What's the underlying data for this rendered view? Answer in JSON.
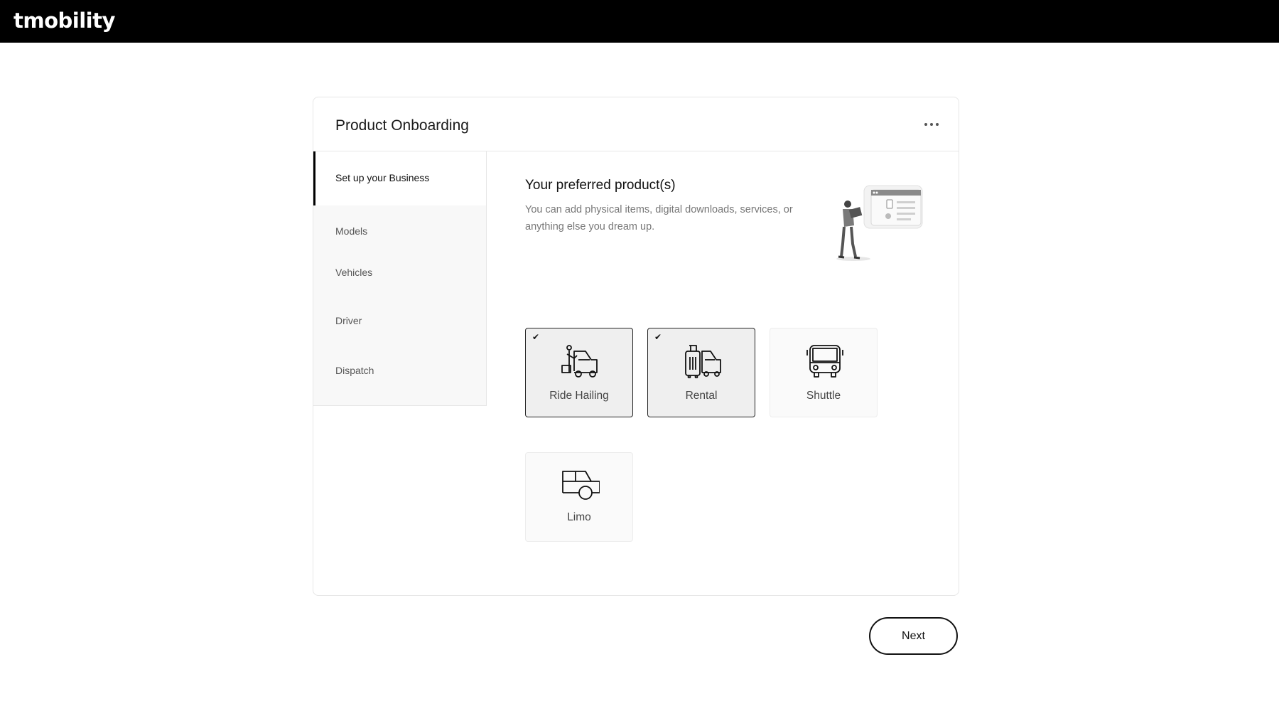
{
  "app": {
    "brand": "tmobility"
  },
  "card": {
    "title": "Product Onboarding",
    "more_icon": "more-horizontal-icon"
  },
  "sidebar": {
    "items": [
      {
        "label": "Set up your Business",
        "active": true
      },
      {
        "label": "Models",
        "active": false
      },
      {
        "label": "Vehicles",
        "active": false
      },
      {
        "label": "Driver",
        "active": false
      },
      {
        "label": "Dispatch",
        "active": false
      }
    ]
  },
  "section": {
    "title": "Your preferred product(s)",
    "description": "You can add physical items, digital downloads, services, or anything else you dream up.",
    "illustration": "person-with-box-illustration"
  },
  "products": [
    {
      "label": "Ride Hailing",
      "icon": "ride-hailing-icon",
      "selected": true
    },
    {
      "label": "Rental",
      "icon": "rental-luggage-icon",
      "selected": true
    },
    {
      "label": "Shuttle",
      "icon": "bus-icon",
      "selected": false
    },
    {
      "label": "Limo",
      "icon": "limo-car-icon",
      "selected": false
    }
  ],
  "actions": {
    "next_label": "Next"
  },
  "colors": {
    "topbar": "#000000",
    "accent": "#111111",
    "selected_tile": "#efefef"
  }
}
